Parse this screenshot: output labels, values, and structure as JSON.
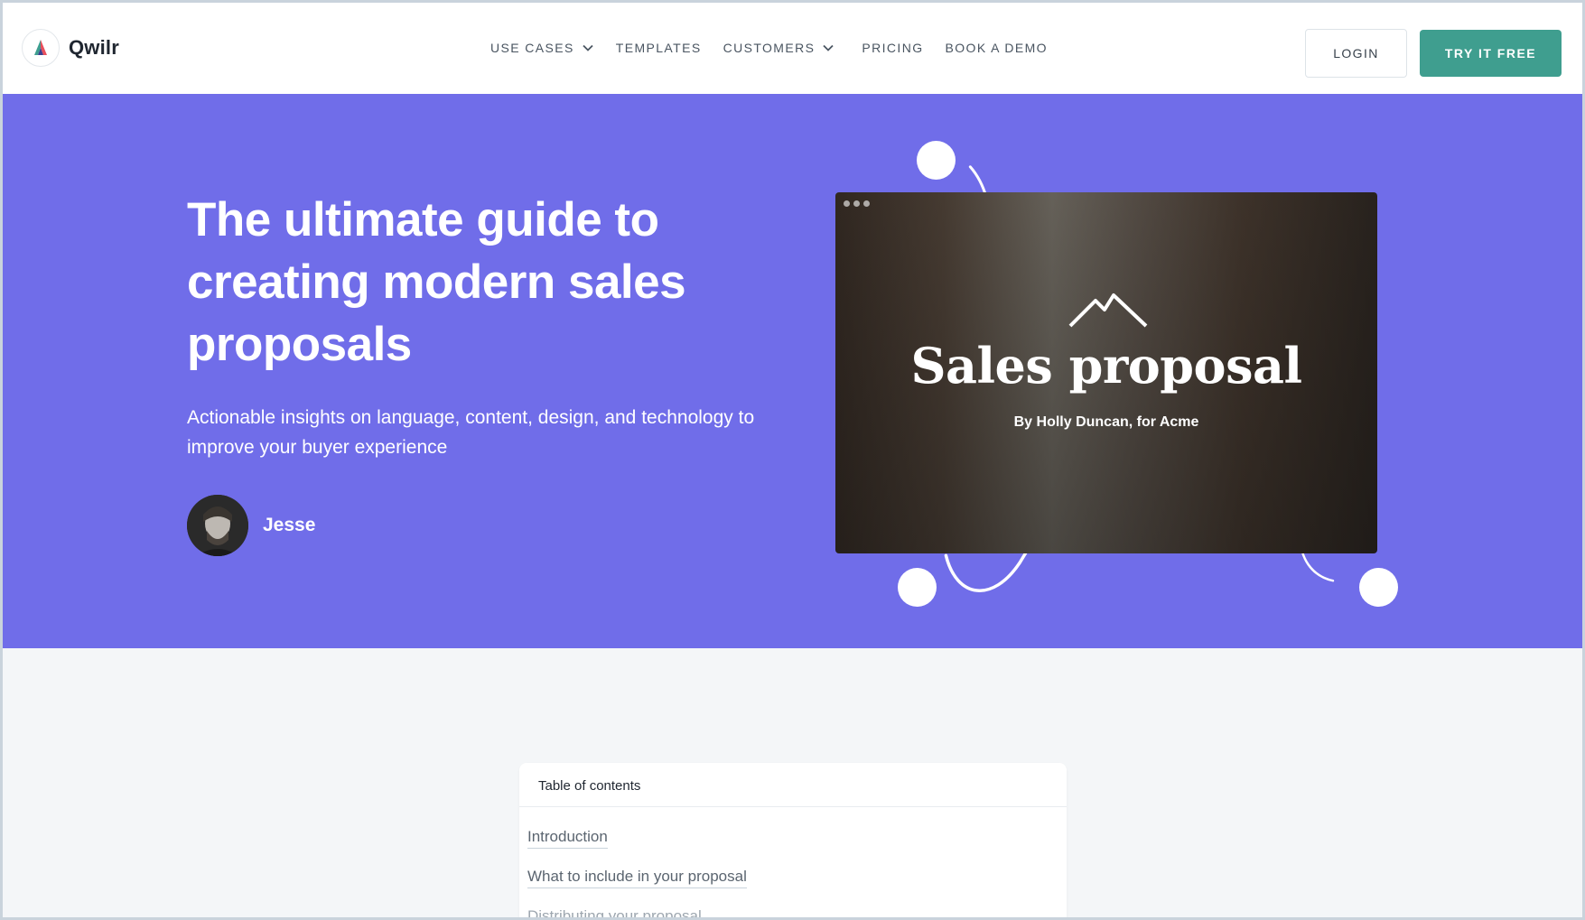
{
  "brand": {
    "name": "Qwilr"
  },
  "nav": {
    "items": [
      {
        "label": "USE CASES",
        "dropdown": true
      },
      {
        "label": "TEMPLATES",
        "dropdown": false
      },
      {
        "label": "CUSTOMERS",
        "dropdown": true
      },
      {
        "label": "PRICING",
        "dropdown": false
      },
      {
        "label": "BOOK A DEMO",
        "dropdown": false
      }
    ],
    "login_label": "LOGIN",
    "cta_label": "TRY IT FREE"
  },
  "hero": {
    "title": "The ultimate guide to creating modern sales proposals",
    "subtitle": "Actionable insights on language, content, design, and technology to improve your buyer experience",
    "author": "Jesse",
    "preview": {
      "title": "Sales proposal",
      "byline": "By Holly Duncan, for Acme"
    }
  },
  "toc": {
    "heading": "Table of contents",
    "items": [
      "Introduction",
      "What to include in your proposal",
      "Distributing your proposal"
    ]
  },
  "colors": {
    "hero_bg": "#706de9",
    "cta_bg": "#3f9e8f",
    "page_bg": "#f4f6f8"
  }
}
